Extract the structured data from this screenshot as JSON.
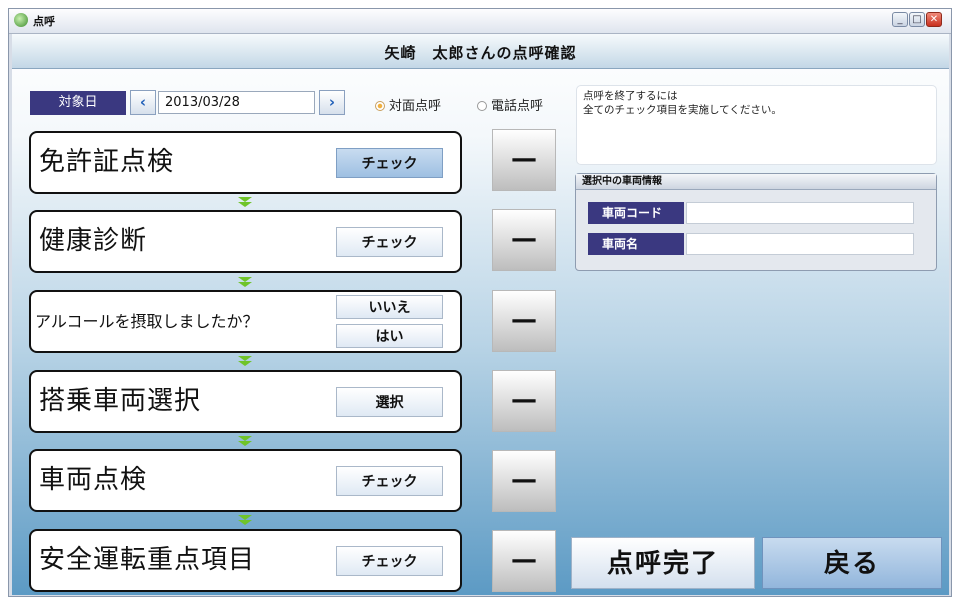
{
  "window": {
    "title": "点呼"
  },
  "header": {
    "title": "矢崎　太郎さんの点呼確認"
  },
  "date": {
    "label": "対象日",
    "value": "2013/03/28",
    "prev_icon": "‹",
    "next_icon": "›"
  },
  "radio": {
    "face": {
      "label": "対面点呼",
      "selected": true
    },
    "phone": {
      "label": "電話点呼",
      "selected": false
    }
  },
  "steps": [
    {
      "label": "免許証点検",
      "button": "チェック",
      "status": "—"
    },
    {
      "label": "健康診断",
      "button": "チェック",
      "status": "—"
    },
    {
      "label": "アルコールを摂取しましたか？",
      "button_no": "いいえ",
      "button_yes": "はい",
      "status": "—"
    },
    {
      "label": "搭乗車両選択",
      "button": "選択",
      "status": "—"
    },
    {
      "label": "車両点検",
      "button": "チェック",
      "status": "—"
    },
    {
      "label": "安全運転重点項目",
      "button": "チェック",
      "status": "—"
    }
  ],
  "message": {
    "line1": "点呼を終了するには",
    "line2": "全てのチェック項目を実施してください。"
  },
  "vehicle": {
    "title": "選択中の車両情報",
    "code_label": "車両コード",
    "code_value": "",
    "name_label": "車両名",
    "name_value": ""
  },
  "actions": {
    "complete": "点呼完了",
    "back": "戻る"
  }
}
